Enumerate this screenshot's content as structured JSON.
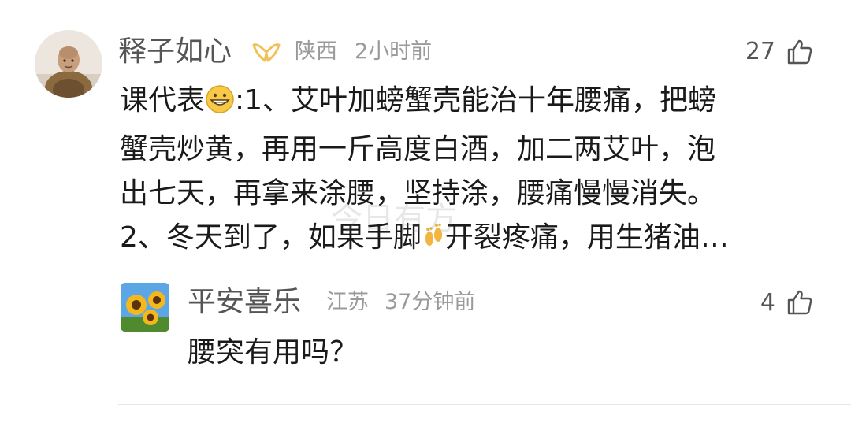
{
  "comments": [
    {
      "author": "释子如心",
      "location": "陕西",
      "time": "2小时前",
      "likes": "27",
      "text_line1_a": "课代表",
      "text_line1_b": ":1、艾叶加螃蟹壳能治十年腰痛，把螃",
      "text_line2": "蟹壳炒黄，再用一斤高度白酒，加二两艾叶，泡",
      "text_line3": "出七天，再拿来涂腰，坚持涂，腰痛慢慢消失。",
      "text_line4_a": "2、冬天到了，如果手脚",
      "text_line4_b": "开裂疼痛，用生猪油…",
      "emoji_1": "grinning-face",
      "emoji_2": "footprints",
      "badge_color": "#f2c25a"
    },
    {
      "author": "平安喜乐",
      "location": "江苏",
      "time": "37分钟前",
      "likes": "4",
      "text": "腰突有用吗？"
    }
  ],
  "watermark": "今日有方",
  "colors": {
    "name": "#555555",
    "meta": "#9a9a9a",
    "text": "#1a1a1a",
    "divider": "#e6e6e6"
  }
}
